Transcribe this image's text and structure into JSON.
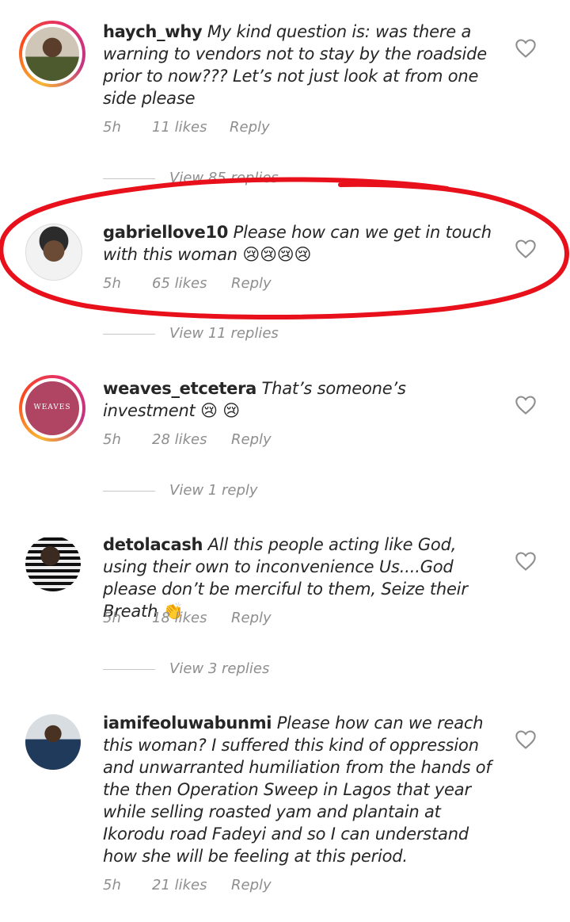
{
  "comments": [
    {
      "username": "haych_why",
      "text": "My kind question is: was there a warning to vendors not to stay by the roadside prior to now??? Let’s not just look at from one side please",
      "time": "5h",
      "likes": "11 likes",
      "reply_label": "Reply",
      "view_replies": "View 85 replies"
    },
    {
      "username": "gabriellove10",
      "text": "Please how can we get in touch with this woman",
      "emojis": "😢😢😢😢",
      "time": "5h",
      "likes": "65 likes",
      "reply_label": "Reply",
      "view_replies": "View 11 replies"
    },
    {
      "username": "weaves_etcetera",
      "text": "That’s someone’s investment",
      "emojis": "😢 😢",
      "avatar_text": "WEAVES",
      "time": "5h",
      "likes": "28 likes",
      "reply_label": "Reply",
      "view_replies": "View 1 reply"
    },
    {
      "username": "detolacash",
      "text": "All this people acting like God, using their own to inconvenience Us....God please don’t be merciful to them, Seize their Breath",
      "emojis": "👏",
      "time": "5h",
      "likes": "18 likes",
      "reply_label": "Reply",
      "view_replies": "View 3 replies"
    },
    {
      "username": "iamifeoluwabunmi",
      "text": "Please how can we reach this woman?  I suffered this kind of oppression and unwarranted humiliation from the hands of the then Operation Sweep in Lagos that year while selling roasted yam and plantain at Ikorodu road Fadeyi and so I can understand how she will be feeling at this period.",
      "time": "5h",
      "likes": "21 likes",
      "reply_label": "Reply"
    }
  ],
  "colors": {
    "annotation": "#e8101a",
    "muted": "#8e8e8e",
    "text": "#262626"
  },
  "icons": [
    "heart-icon"
  ]
}
